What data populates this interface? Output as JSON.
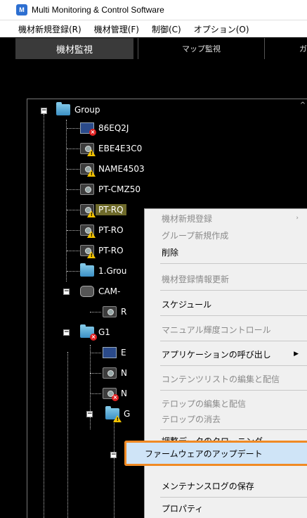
{
  "window": {
    "title": "Multi Monitoring & Control Software",
    "app_icon": "app-logo-icon"
  },
  "menubar": {
    "items": [
      "機材新規登録(R)",
      "機材管理(F)",
      "制御(C)",
      "オプション(O)"
    ]
  },
  "tabs": [
    {
      "label": "機材監視",
      "active": true
    },
    {
      "label": "マップ監視",
      "active": false
    },
    {
      "label": "ガ",
      "active": false
    }
  ],
  "tree": {
    "root": "Group",
    "nodes": [
      {
        "label": "86EQ2J",
        "icon": "monitor-icon",
        "status": "error"
      },
      {
        "label": "EBE4E3C0",
        "icon": "projector-icon",
        "status": "warning"
      },
      {
        "label": "NAME4503",
        "icon": "projector-icon",
        "status": "warning"
      },
      {
        "label": "PT-CMZ50",
        "icon": "projector-icon",
        "status": "normal"
      },
      {
        "label": "PT-RQ",
        "icon": "projector-icon",
        "status": "warning",
        "selected": true
      },
      {
        "label": "PT-RO",
        "icon": "projector-icon",
        "status": "warning"
      },
      {
        "label": "PT-RO",
        "icon": "projector-icon",
        "status": "warning"
      },
      {
        "label": "1.Grou",
        "icon": "folder-icon",
        "status": "normal"
      },
      {
        "label": "CAM-",
        "icon": "camera-icon",
        "status": "normal"
      },
      {
        "label": "R",
        "icon": "projector-icon",
        "status": "normal"
      },
      {
        "label": "G1",
        "icon": "folder-icon",
        "status": "error"
      },
      {
        "label": "E",
        "icon": "monitor-icon",
        "status": "normal"
      },
      {
        "label": "N",
        "icon": "projector-icon",
        "status": "normal"
      },
      {
        "label": "N",
        "icon": "projector-icon",
        "status": "error"
      },
      {
        "label": "G",
        "icon": "folder-icon",
        "status": "warning"
      }
    ]
  },
  "context_menu": {
    "items": [
      {
        "label": "機材新規登録",
        "enabled": false,
        "submenu": true
      },
      {
        "label": "グループ新規作成",
        "enabled": false
      },
      {
        "label": "削除",
        "enabled": true
      },
      {
        "label": "機材登録情報更新",
        "enabled": false
      },
      {
        "label": "スケジュール",
        "enabled": true
      },
      {
        "label": "マニュアル輝度コントロール",
        "enabled": false
      },
      {
        "label": "アプリケーションの呼び出し",
        "enabled": true,
        "submenu": true
      },
      {
        "label": "コンテンツリストの編集と配信",
        "enabled": false
      },
      {
        "label": "テロップの編集と配信",
        "enabled": false
      },
      {
        "label": "テロップの消去",
        "enabled": false
      },
      {
        "label": "調整データのクローニング",
        "enabled": true
      },
      {
        "label": "ファームウェアのアップデート",
        "enabled": true,
        "highlighted": true
      },
      {
        "label": "メンテナンスログの保存",
        "enabled": true
      },
      {
        "label": "プロパティ",
        "enabled": true
      }
    ]
  },
  "colors": {
    "highlight_border": "#f08a24",
    "selection": "#6e6a2a",
    "warning": "#f2c200",
    "error": "#e02020"
  }
}
